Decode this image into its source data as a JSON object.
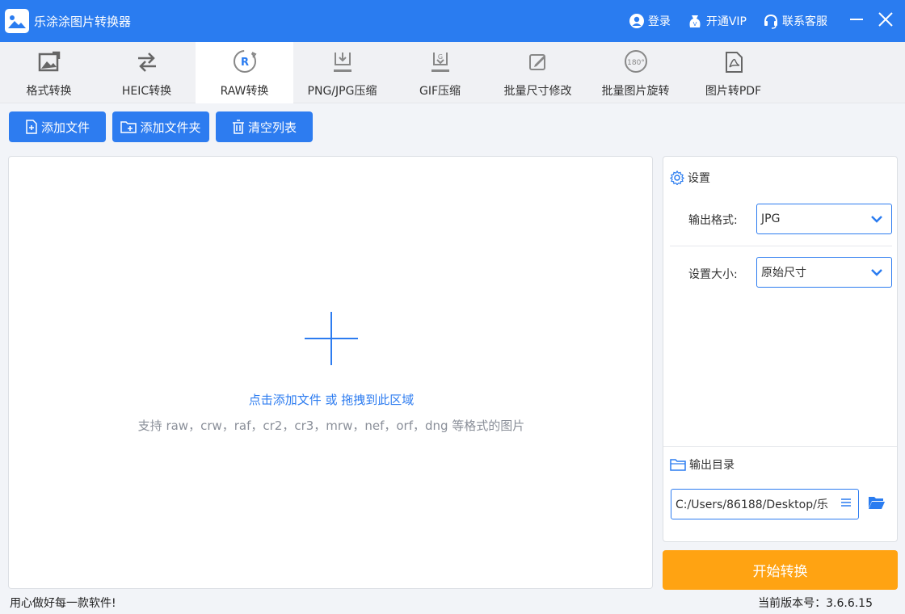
{
  "app": {
    "title": "乐涂涂图片转换器",
    "logo_icon": "image-logo-icon"
  },
  "titlebar": {
    "login": "登录",
    "vip": "开通VIP",
    "support": "联系客服",
    "minimize_icon": "minimize-icon",
    "close_icon": "close-icon"
  },
  "tabs": [
    {
      "label": "格式转换",
      "icon": "format-convert-icon"
    },
    {
      "label": "HEIC转换",
      "icon": "swap-arrows-icon"
    },
    {
      "label": "RAW转换",
      "icon": "raw-r-icon",
      "active": true
    },
    {
      "label": "PNG/JPG压缩",
      "icon": "compress-icon"
    },
    {
      "label": "GIF压缩",
      "icon": "gif-compress-icon"
    },
    {
      "label": "批量尺寸修改",
      "icon": "edit-size-icon"
    },
    {
      "label": "批量图片旋转",
      "icon": "rotate-180-icon"
    },
    {
      "label": "图片转PDF",
      "icon": "pdf-icon"
    }
  ],
  "toolbar": {
    "add_file": "添加文件",
    "add_folder": "添加文件夹",
    "clear_list": "清空列表"
  },
  "dropzone": {
    "main_text": "点击添加文件 或 拖拽到此区域",
    "sub_text": "支持 raw，crw，raf，cr2，cr3，mrw，nef，orf，dng 等格式的图片"
  },
  "settings": {
    "title": "设置",
    "output_format_label": "输出格式:",
    "output_format_value": "JPG",
    "size_label": "设置大小:",
    "size_value": "原始尺寸",
    "output_dir_title": "输出目录",
    "output_dir_value": "C:/Users/86188/Desktop/乐"
  },
  "start_button": "开始转换",
  "status": {
    "slogan": "用心做好每一款软件!",
    "version": "当前版本号：3.6.6.15"
  },
  "colors": {
    "primary": "#2a7cf0",
    "accent": "#ffa312",
    "background": "#f2f4f8"
  }
}
